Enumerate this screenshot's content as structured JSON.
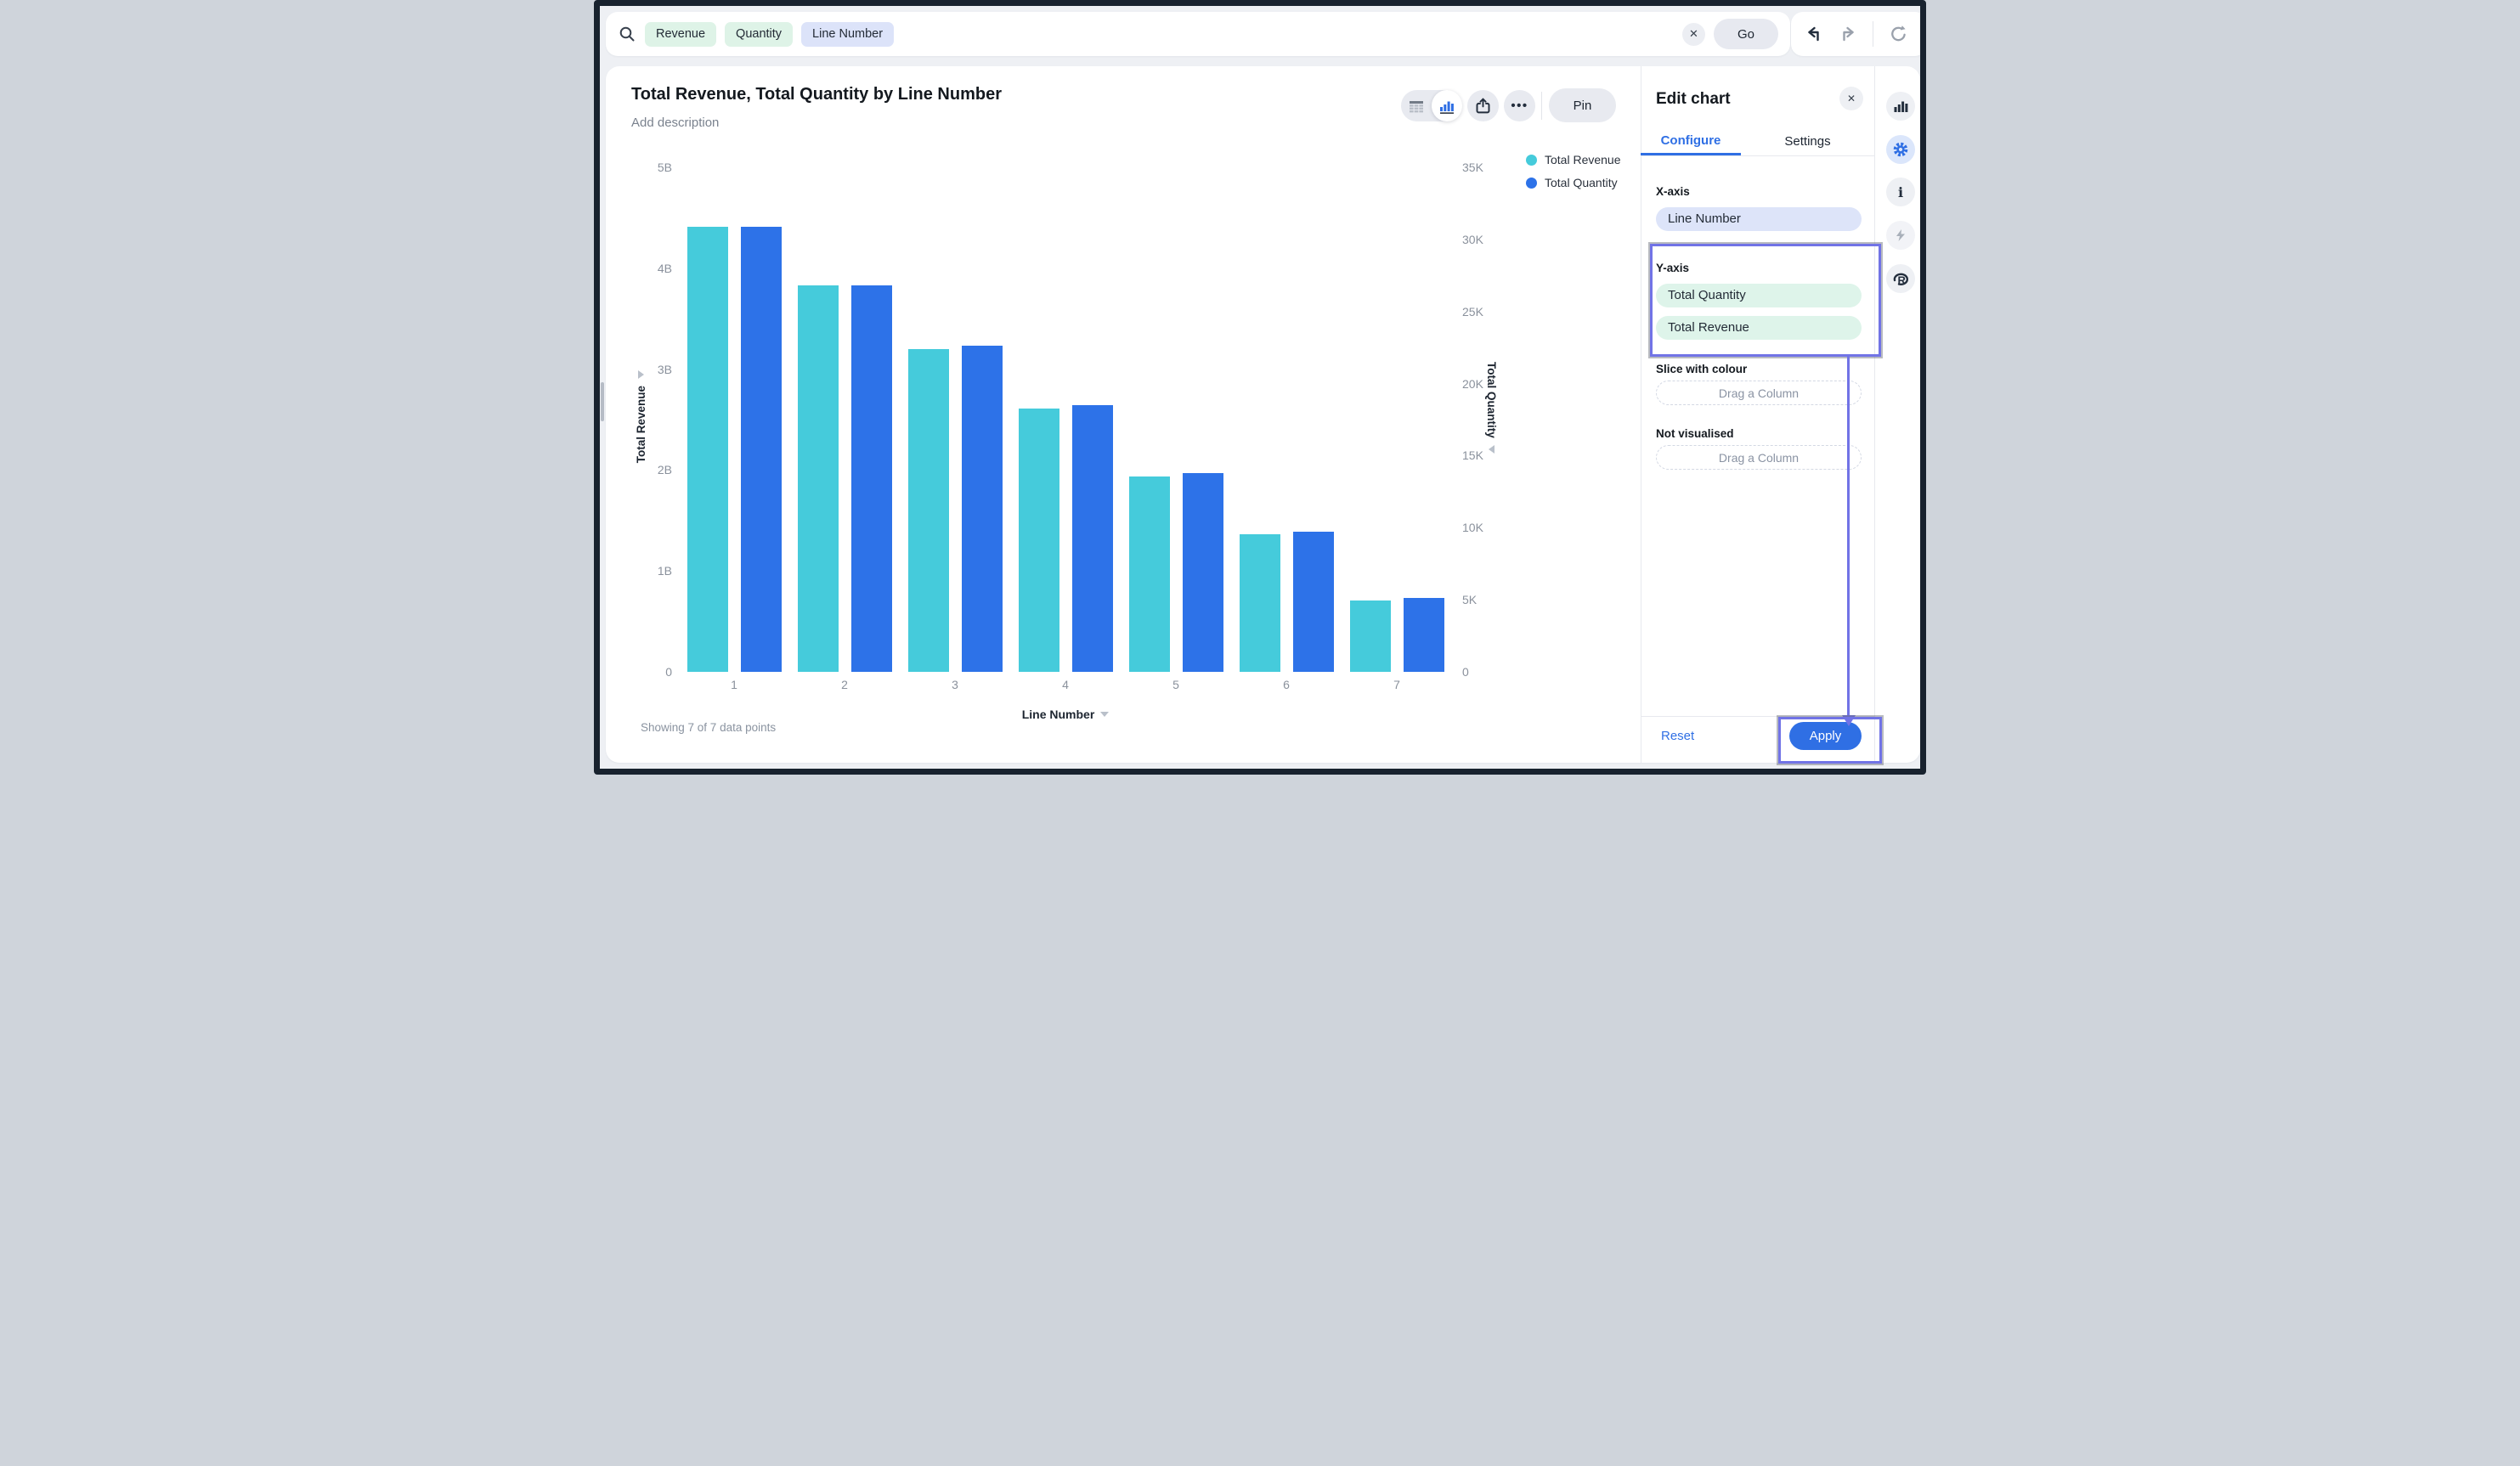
{
  "topbar": {
    "search_tags": [
      {
        "label": "Revenue",
        "type": "green"
      },
      {
        "label": "Quantity",
        "type": "green"
      },
      {
        "label": "Line Number",
        "type": "blue"
      }
    ],
    "go_label": "Go"
  },
  "chart_header": {
    "title": "Total Revenue, Total Quantity by Line Number",
    "description_placeholder": "Add description",
    "pin_label": "Pin"
  },
  "legend": [
    {
      "label": "Total Revenue",
      "color": "#45CBDB"
    },
    {
      "label": "Total Quantity",
      "color": "#2D72E8"
    }
  ],
  "chart_data": {
    "type": "bar",
    "title": "Total Revenue, Total Quantity by Line Number",
    "categories": [
      "1",
      "2",
      "3",
      "4",
      "5",
      "6",
      "7"
    ],
    "xlabel": "Line Number",
    "series": [
      {
        "name": "Total Revenue",
        "axis": "left",
        "unit": "B",
        "color": "#45CBDB",
        "values": [
          4.41,
          3.83,
          3.2,
          2.61,
          1.94,
          1.36,
          0.71
        ]
      },
      {
        "name": "Total Quantity",
        "axis": "right",
        "unit": "K",
        "color": "#2D72E8",
        "values": [
          30.9,
          26.8,
          22.6,
          18.5,
          13.8,
          9.7,
          5.1
        ]
      }
    ],
    "y_left": {
      "label": "Total Revenue",
      "max": 5,
      "ticks": [
        "5B",
        "4B",
        "3B",
        "2B",
        "1B",
        "0"
      ]
    },
    "y_right": {
      "label": "Total Quantity",
      "max": 35,
      "ticks": [
        "35K",
        "30K",
        "25K",
        "20K",
        "15K",
        "10K",
        "5K",
        "0"
      ]
    },
    "grid": false,
    "legend_position": "top-right"
  },
  "footer_note": "Showing 7 of 7 data points",
  "edit_panel": {
    "title": "Edit chart",
    "tabs": {
      "configure": "Configure",
      "settings": "Settings"
    },
    "active_tab": "Configure",
    "x_axis": {
      "label": "X-axis",
      "fields": [
        "Line Number"
      ]
    },
    "y_axis": {
      "label": "Y-axis",
      "fields": [
        "Total Quantity",
        "Total Revenue"
      ]
    },
    "slice": {
      "label": "Slice with colour",
      "placeholder": "Drag a Column"
    },
    "not_visualised": {
      "label": "Not visualised",
      "placeholder": "Drag a Column"
    },
    "reset_label": "Reset",
    "apply_label": "Apply"
  },
  "colors": {
    "accent_blue": "#2F6FE4",
    "bar_cyan": "#45CBDB",
    "bar_blue": "#2D72E8",
    "annotation_purple": "#7173E6",
    "tag_green_bg": "#DEF3E7",
    "tag_blue_bg": "#DCE3F9",
    "pill_mint_bg": "#DEF4EA",
    "pill_lavender_bg": "#DDE4F9",
    "frame_dark": "#18222E"
  }
}
